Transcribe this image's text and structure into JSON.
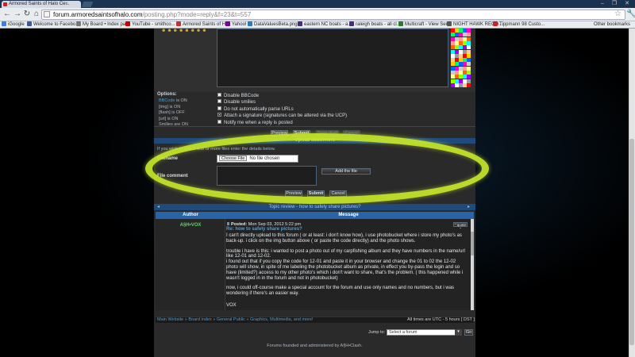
{
  "browser": {
    "tab_title": "Armored Saints of Halo Ce...",
    "tab_close": "×",
    "window_controls": [
      "–",
      "❐",
      "✕"
    ],
    "url_host": "forum.armoredsaintsofhalo.com",
    "url_path": "/posting.php?mode=reply&f=23&t=557",
    "bookmarks": [
      {
        "label": "iGoogle",
        "color": "#3b7de0"
      },
      {
        "label": "Welcome to Facebo...",
        "color": "#3b5998"
      },
      {
        "label": "My Board • Index pa...",
        "color": "#777777"
      },
      {
        "label": "YouTube - smithco...",
        "color": "#cc0000"
      },
      {
        "label": "Armored Saints of H...",
        "color": "#c33333"
      },
      {
        "label": "Yahoo!",
        "color": "#7b0099"
      },
      {
        "label": "DataValuesBeta.png ...",
        "color": "#2b7bb9"
      },
      {
        "label": "eastern NC boats - a...",
        "color": "#4b2a7b"
      },
      {
        "label": "raleigh boats - all cl...",
        "color": "#4b2a7b"
      },
      {
        "label": "Multicraft - View Ser...",
        "color": "#2c7a2c"
      },
      {
        "label": "NIGHT HAWK RECO...",
        "color": "#555555"
      },
      {
        "label": "Tippmann 98 Custo...",
        "color": "#cc2222"
      }
    ],
    "other_bookmarks": "Other bookmarks"
  },
  "editor": {
    "smilies": "☻☻☻☻☻☻☻☻",
    "options_title": "Options:",
    "options_status": [
      {
        "name": "BBCode",
        "state": "is ON",
        "link": true
      },
      {
        "name": "[img]",
        "state": "is ON",
        "link": false
      },
      {
        "name": "[flash]",
        "state": "is OFF",
        "link": false
      },
      {
        "name": "[url]",
        "state": "is ON",
        "link": false
      },
      {
        "name": "Smilies",
        "state": "are ON",
        "link": false
      }
    ],
    "checkboxes": [
      {
        "label": "Disable BBCode",
        "checked": false
      },
      {
        "label": "Disable smilies",
        "checked": false
      },
      {
        "label": "Do not automatically parse URLs",
        "checked": false
      },
      {
        "label": "Attach a signature (signatures can be altered via the UCP)",
        "checked": true
      },
      {
        "label": "Notify me when a reply is posted",
        "checked": false
      }
    ],
    "buttons": {
      "preview": "Preview",
      "submit": "Submit",
      "save_draft": "Save draft",
      "cancel": "Cancel"
    }
  },
  "upload": {
    "header": "Upload attachment",
    "intro": "If you wish to attach one or more files enter the details below.",
    "filename_label": "Filename",
    "choose_file": "Choose File",
    "no_file": "No file chosen",
    "add_file": "Add the file",
    "file_comment_label": "File comment",
    "buttons": {
      "preview": "Preview",
      "submit": "Submit",
      "cancel": "Cancel"
    }
  },
  "topic_review": {
    "header": "Topic review - how to safely share pictures?",
    "col_author": "Author",
    "col_message": "Message",
    "author": "A§H•VOX",
    "posted_label": "Posted:",
    "posted_date": "Mon Sep 03, 2012 5:22 pm",
    "quote": "\" quote \"",
    "post_title": "Re: how to safely share pictures?",
    "paragraphs": [
      "I can't directly upload to this forum ( or at least: i don't know how), i use photobucket where i store my photo's as back-up. i click on the img button above ( or paste the code directly) and the photo shows.",
      "trouble i have is this: i wanted to post a photo out of my carpfishing album and they have numbers in the name/url like 12-01 and 12-02.",
      "i found out that if you copy the code for 12-01 and paste it in your browser and change the 01 to 02 the 12-02 photo will show, in spite of me labeling the photobucket album as private, in effect you by-pass the login and so have (limited?) access to my other photo's which i don't want to share, that's the problem. ( this happened while i wasn't logged in in the forum and not in photobucket)",
      "now, i could off-course make a special account for the forum and use only names and no numbers, but i was wondering if there's an easier way.",
      "VOX"
    ]
  },
  "footer": {
    "breadcrumbs": [
      "Main Website",
      "Board index",
      "General Public",
      "Graphics, Multimedia, and more!"
    ],
    "timezone": "All times are UTC - 5 hours [ DST ]",
    "jump_to": "Jump to:",
    "select_forum": "Select a forum",
    "go": "Go",
    "founded": "Forums founded and administered by A§H•Clash."
  },
  "colors": {
    "accent_blue": "#2a64a8",
    "link": "#4d9fd6",
    "author_green": "#5fd46a",
    "highlight": "#c8e828"
  }
}
